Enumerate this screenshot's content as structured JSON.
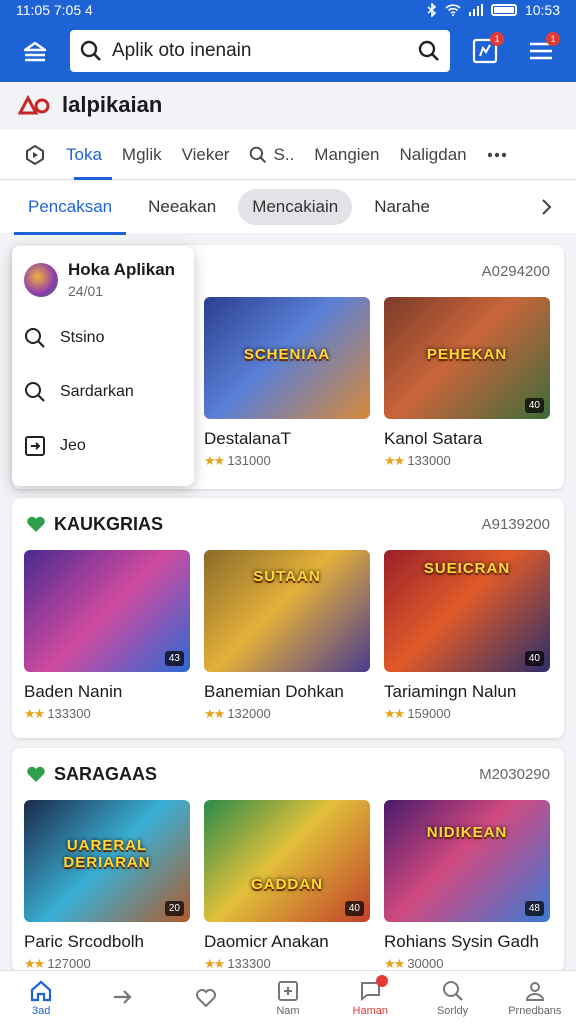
{
  "status": {
    "time": "11:05 7:05 4",
    "clock": "10:53"
  },
  "search": {
    "placeholder": "Aplik oto inenain"
  },
  "header": {
    "notification_count": "1",
    "menu_badge": "1"
  },
  "brand": {
    "name": "lalpikaian"
  },
  "tabs": [
    {
      "label": "Toka"
    },
    {
      "label": "Mglik"
    },
    {
      "label": "Vieker"
    },
    {
      "label": "S.."
    },
    {
      "label": "Mangien"
    },
    {
      "label": "Naligdan"
    }
  ],
  "subtabs": [
    {
      "label": "Pencaksan"
    },
    {
      "label": "Neeakan"
    },
    {
      "label": "Mencakiain"
    },
    {
      "label": "Narahe"
    }
  ],
  "popup": {
    "title": "Hoka Aplikan",
    "subtitle": "24/01",
    "items": [
      {
        "label": "Stsino"
      },
      {
        "label": "Sardarkan"
      },
      {
        "label": "Jeo"
      }
    ]
  },
  "sections": [
    {
      "title": "",
      "count": "A0294200",
      "cards": [
        {
          "name": "",
          "rating": "",
          "thumb_title": "",
          "tag": ""
        },
        {
          "name": "DestalanaT",
          "rating": "131000",
          "thumb_title": "SCHENIAA",
          "tag": ""
        },
        {
          "name": "Kanol Satara",
          "rating": "133000",
          "thumb_title": "PEHEKAN",
          "tag": "40"
        }
      ]
    },
    {
      "title": "KAUKGRIAS",
      "count": "A9139200",
      "cards": [
        {
          "name": "Baden Nanin",
          "rating": "133300",
          "thumb_title": "",
          "tag": "43"
        },
        {
          "name": "Banemian Dohkan",
          "rating": "132000",
          "thumb_title": "SUTAAN",
          "tag": ""
        },
        {
          "name": "Tariamingn Nalun",
          "rating": "159000",
          "thumb_title": "SUEICRAN",
          "tag": "40"
        }
      ]
    },
    {
      "title": "SARAGAAS",
      "count": "M2030290",
      "cards": [
        {
          "name": "Paric Srcodbolh",
          "rating": "127000",
          "thumb_title": "UARERAL DERIARAN",
          "tag": "20"
        },
        {
          "name": "Daomicr Anakan",
          "rating": "133300",
          "thumb_title": "GADDAN",
          "tag": "40"
        },
        {
          "name": "Rohians Sysin Gadh",
          "rating": "30000",
          "thumb_title": "NIDIKEAN",
          "tag": "48"
        }
      ]
    }
  ],
  "bottom_nav": [
    {
      "label": "3ad"
    },
    {
      "label": ""
    },
    {
      "label": ""
    },
    {
      "label": "Nam"
    },
    {
      "label": "Haman"
    },
    {
      "label": "Sorldy"
    },
    {
      "label": "Prnedbans"
    }
  ]
}
